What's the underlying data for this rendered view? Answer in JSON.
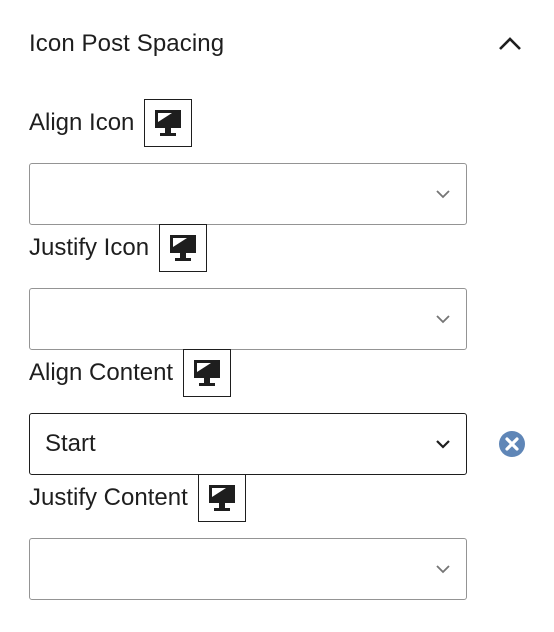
{
  "panel": {
    "title": "Icon Post Spacing",
    "collapse_icon": "chevron-up-icon"
  },
  "fields": [
    {
      "label": "Align Icon",
      "device_icon": "desktop-icon",
      "value": ""
    },
    {
      "label": "Justify Icon",
      "device_icon": "desktop-icon",
      "value": ""
    },
    {
      "label": "Align Content",
      "device_icon": "desktop-icon",
      "value": "Start",
      "clear_icon": "clear-x-circle-icon",
      "clear_color": "#5f86b7"
    },
    {
      "label": "Justify Content",
      "device_icon": "desktop-icon",
      "value": ""
    }
  ]
}
